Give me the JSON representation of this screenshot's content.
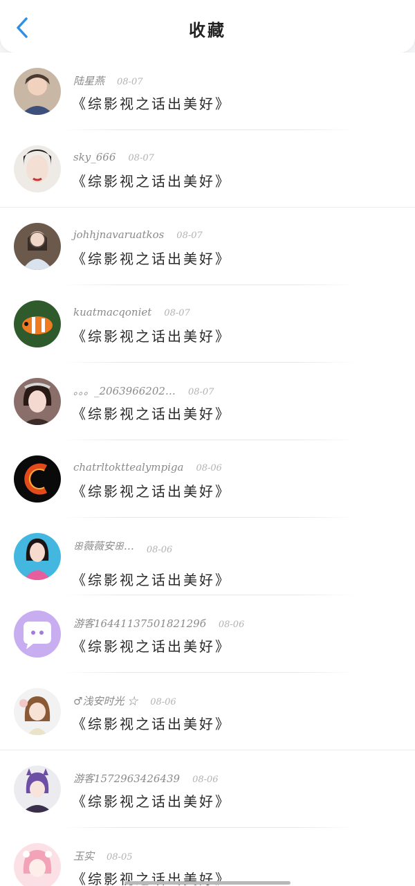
{
  "header": {
    "title": "收藏",
    "back_icon": "chevron-left-icon",
    "accent": "#2f8fe6"
  },
  "items": [
    {
      "user": "陆星燕",
      "date": "08-07",
      "book": "《综影视之话出美好》"
    },
    {
      "user": "sky_666",
      "date": "08-07",
      "book": "《综影视之话出美好》"
    },
    {
      "user": "johhjnavaruatkos",
      "date": "08-07",
      "book": "《综影视之话出美好》"
    },
    {
      "user": "kuatmacqoniet",
      "date": "08-07",
      "book": "《综影视之话出美好》"
    },
    {
      "user": "。。。_2063966202…",
      "date": "08-07",
      "book": "《综影视之话出美好》"
    },
    {
      "user": "chatrltokttealympiga",
      "date": "08-06",
      "book": "《综影视之话出美好》"
    },
    {
      "user": "ꕥ薇薇安ꕥ…",
      "date": "08-06",
      "book": "《综影视之话出美好》"
    },
    {
      "user": "游客1644113750182129б",
      "date": "08-06",
      "book": "《综影视之话出美好》"
    },
    {
      "user": "♂浅安时光 ☆",
      "date": "08-06",
      "book": "《综影视之话出美好》"
    },
    {
      "user": "游客1572963426439",
      "date": "08-06",
      "book": "《综影视之话出美好》"
    },
    {
      "user": "玉实",
      "date": "08-05",
      "book": "《综影视之话出美好》"
    }
  ]
}
